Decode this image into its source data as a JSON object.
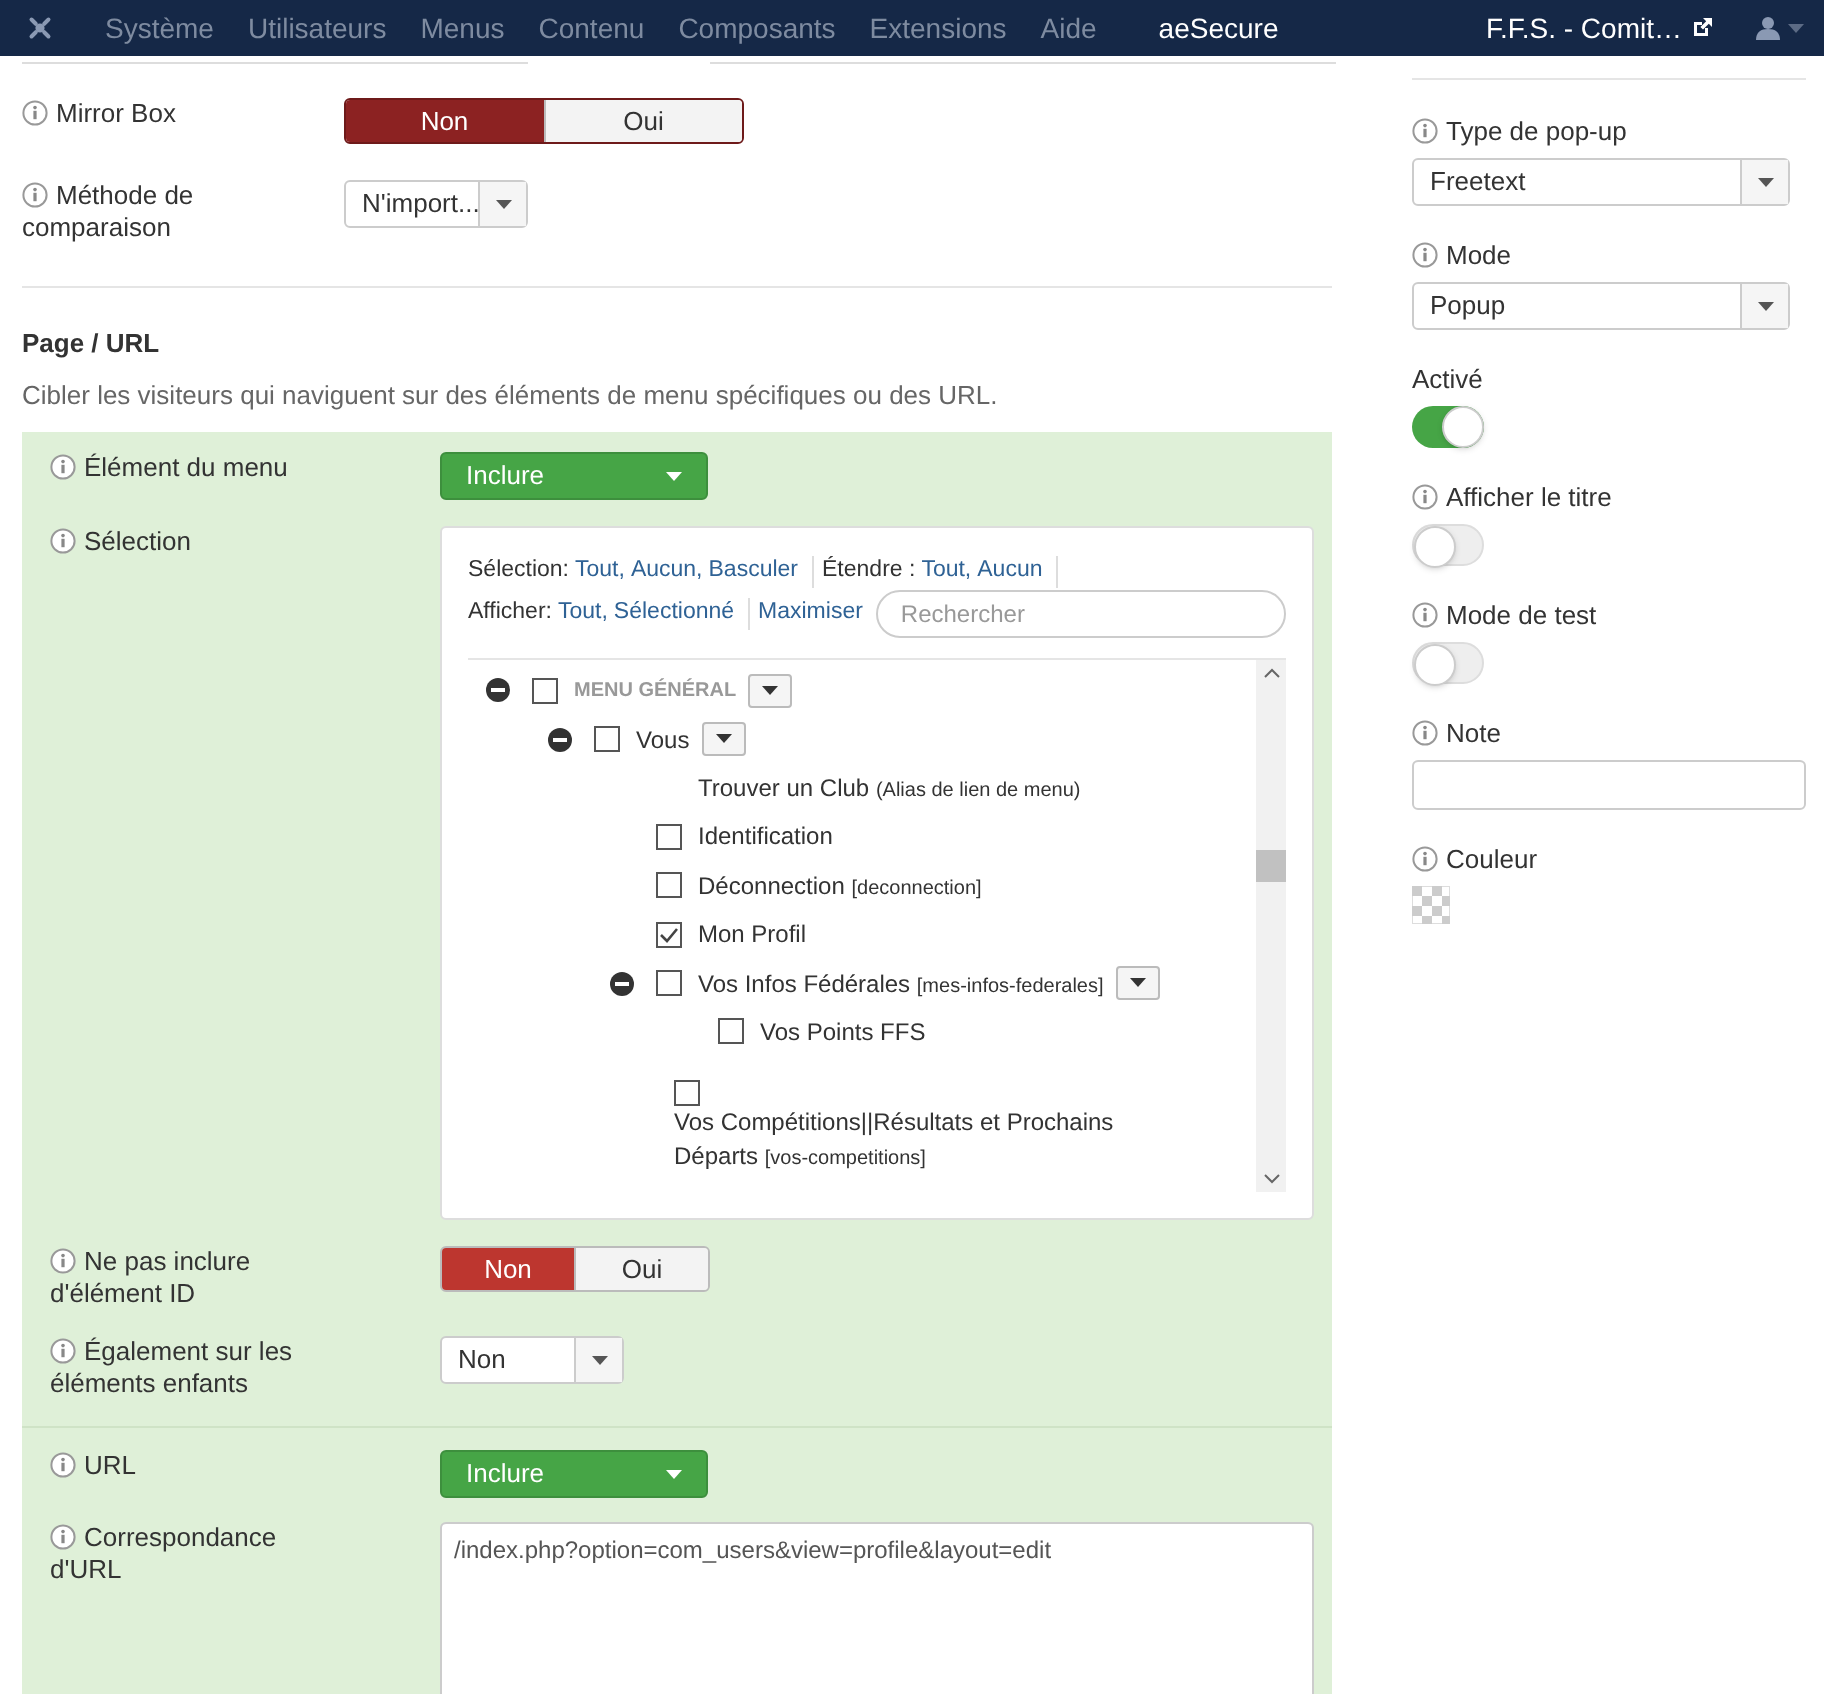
{
  "navbar": {
    "menu": [
      {
        "label": "Système",
        "active": false
      },
      {
        "label": "Utilisateurs",
        "active": false
      },
      {
        "label": "Menus",
        "active": false
      },
      {
        "label": "Contenu",
        "active": false
      },
      {
        "label": "Composants",
        "active": false
      },
      {
        "label": "Extensions",
        "active": false
      },
      {
        "label": "Aide",
        "active": false
      },
      {
        "label": "aeSecure",
        "active": true
      }
    ],
    "site_link": "F.F.S. - Comit…"
  },
  "fields": [
    {
      "kind": "toggle",
      "label": "Mirror Box",
      "options": [
        {
          "label": "Non",
          "selected": true
        },
        {
          "label": "Oui",
          "selected": false
        }
      ]
    },
    {
      "kind": "select",
      "label": "Méthode de comparaison",
      "value": "N'import..."
    }
  ],
  "section": {
    "title": "Page / URL",
    "description": "Cibler les visiteurs qui naviguent sur des éléments de menu spécifiques ou des URL."
  },
  "panel": [
    [
      {
        "kind": "green_select",
        "label": "Élément du menu",
        "value": "Inclure"
      },
      {
        "kind": "tree",
        "label": "Sélection",
        "toolbar": [
          [
            {
              "kind": "label",
              "text": "Sélection:"
            },
            {
              "kind": "link",
              "text": "Tout,"
            },
            {
              "kind": "link",
              "text": "Aucun,"
            },
            {
              "kind": "link",
              "text": "Basculer"
            },
            {
              "kind": "sep"
            },
            {
              "kind": "label",
              "text": "Étendre :"
            },
            {
              "kind": "link",
              "text": "Tout,"
            },
            {
              "kind": "link",
              "text": "Aucun"
            },
            {
              "kind": "sep"
            }
          ],
          [
            {
              "kind": "label",
              "text": "Afficher:"
            },
            {
              "kind": "link",
              "text": "Tout,"
            },
            {
              "kind": "link",
              "text": "Sélectionné"
            },
            {
              "kind": "sep"
            },
            {
              "kind": "link",
              "text": "Maximiser"
            },
            {
              "kind": "search",
              "placeholder": "Rechercher"
            }
          ]
        ],
        "items": [
          {
            "kind": "heading",
            "label": "MENU GÉNÉRAL",
            "checked": false,
            "expanded": true,
            "children": [
              {
                "kind": "item",
                "label": "Vous",
                "checked": false,
                "expanded": true,
                "children": [
                  {
                    "kind": "alias",
                    "label": "Trouver un Club",
                    "note": "(Alias de lien de menu)"
                  },
                  {
                    "kind": "item",
                    "label": "Identification",
                    "checked": false
                  },
                  {
                    "kind": "item",
                    "label": "Déconnection",
                    "note": "[deconnection]",
                    "checked": false
                  },
                  {
                    "kind": "item",
                    "label": "Mon Profil",
                    "checked": true
                  },
                  {
                    "kind": "item",
                    "label": "Vos Infos Fédérales",
                    "note": "[mes-infos-federales]",
                    "checked": false,
                    "expanded": true,
                    "children": [
                      {
                        "kind": "item",
                        "label": "Vos Points FFS",
                        "checked": false
                      }
                    ]
                  },
                  {
                    "kind": "wrapped",
                    "label": "Vos Compétitions||Résultats et Prochains Départs",
                    "note": "[vos-competitions]",
                    "checked": false
                  }
                ]
              }
            ]
          }
        ]
      },
      {
        "kind": "toggle",
        "label": "Ne pas inclure d'élément ID",
        "options": [
          {
            "label": "Non",
            "selected": true
          },
          {
            "label": "Oui",
            "selected": false
          }
        ]
      },
      {
        "kind": "select",
        "label": "Également sur les éléments enfants",
        "value": "Non"
      }
    ],
    [
      {
        "kind": "green_select",
        "label": "URL",
        "value": "Inclure"
      },
      {
        "kind": "textarea",
        "label": "Correspondance d'URL",
        "value": "/index.php?option=com_users&view=profile&layout=edit"
      }
    ]
  ],
  "sidebar": [
    {
      "kind": "select",
      "label": "Type de pop-up",
      "info": true,
      "value": "Freetext"
    },
    {
      "kind": "select",
      "label": "Mode",
      "info": true,
      "value": "Popup"
    },
    {
      "kind": "switch",
      "label": "Activé",
      "info": false,
      "on": true
    },
    {
      "kind": "switch",
      "label": "Afficher le titre",
      "info": true,
      "on": false
    },
    {
      "kind": "switch",
      "label": "Mode de test",
      "info": true,
      "on": false
    },
    {
      "kind": "input",
      "label": "Note",
      "info": true
    },
    {
      "kind": "color",
      "label": "Couleur",
      "info": true
    }
  ]
}
